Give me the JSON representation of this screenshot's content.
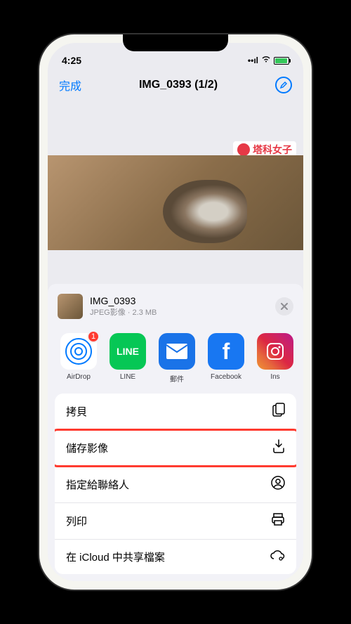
{
  "status": {
    "time": "4:25"
  },
  "nav": {
    "done": "完成",
    "title": "IMG_0393 (1/2)"
  },
  "watermark": {
    "text": "塔科女子"
  },
  "share": {
    "filename": "IMG_0393",
    "filetype": "JPEG影像",
    "filesize": "2.3 MB",
    "badge_count": "1"
  },
  "apps": {
    "airdrop": "AirDrop",
    "line": "LINE",
    "line_text": "LINE",
    "mail": "郵件",
    "facebook": "Facebook",
    "instagram": "Ins"
  },
  "actions": {
    "copy": "拷貝",
    "save_image": "儲存影像",
    "assign_contact": "指定給聯絡人",
    "print": "列印",
    "icloud_share": "在 iCloud 中共享檔案"
  }
}
